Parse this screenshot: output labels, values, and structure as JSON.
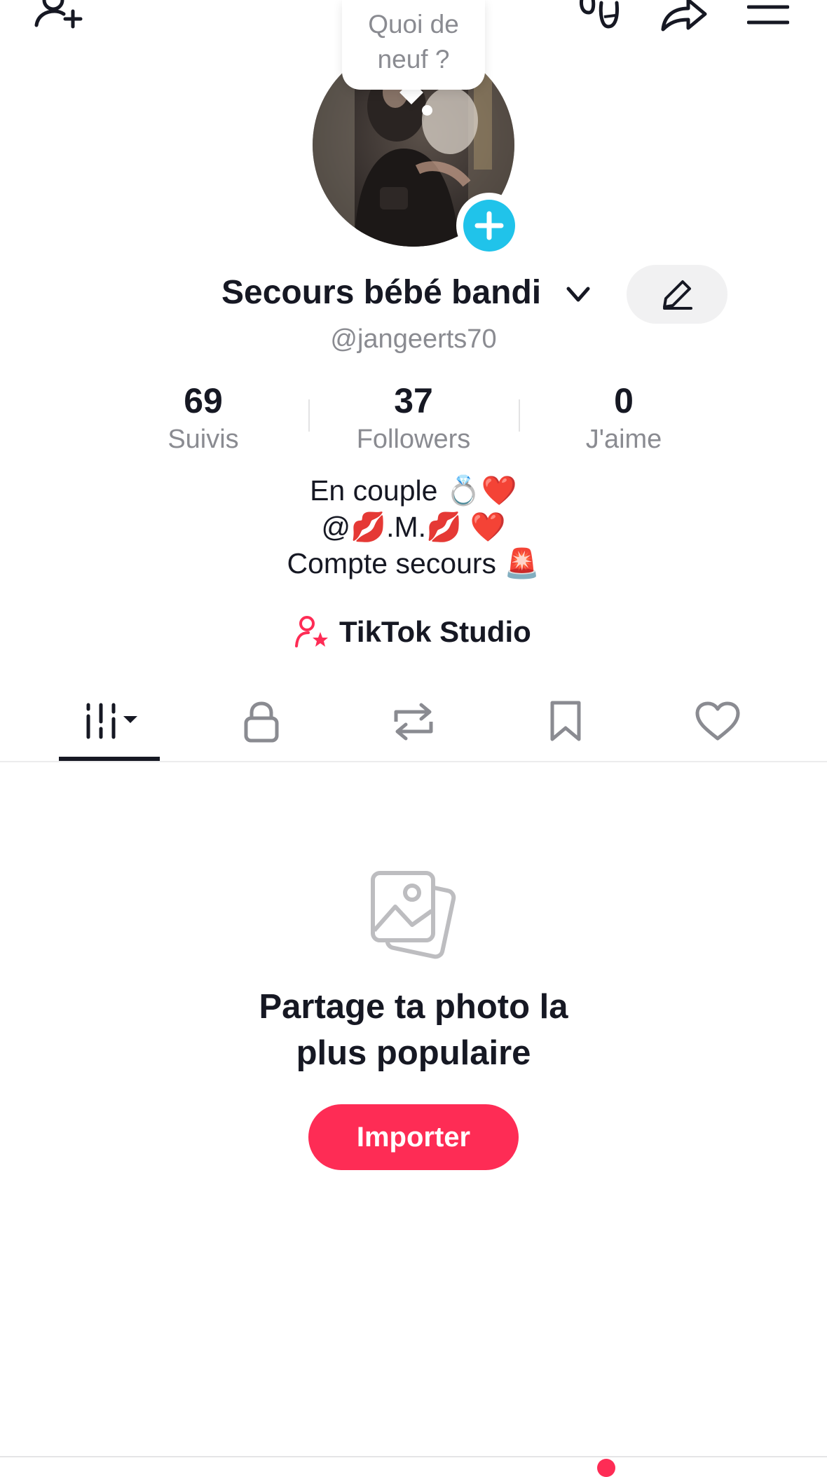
{
  "top_bar": {
    "add_friend_icon": "person-plus-icon",
    "footprints_icon": "footprints-icon",
    "share_icon": "share-arrow-icon",
    "menu_icon": "hamburger-menu-icon"
  },
  "status_bubble": {
    "line1": "Quoi de",
    "line2": "neuf ?"
  },
  "profile": {
    "display_name": "Secours bébé bandi",
    "handle": "@jangeerts70"
  },
  "stats": [
    {
      "value": "69",
      "label": "Suivis"
    },
    {
      "value": "37",
      "label": "Followers"
    },
    {
      "value": "0",
      "label": "J'aime"
    }
  ],
  "bio": {
    "line1": "En couple 💍❤️",
    "line2": "@💋.M.💋 ❤️",
    "line3": "Compte secours 🚨"
  },
  "studio": {
    "label": "TikTok Studio"
  },
  "tabs": [
    {
      "name": "grid-filter",
      "icon": "grid-dropdown-icon",
      "active": true
    },
    {
      "name": "private",
      "icon": "lock-icon",
      "active": false
    },
    {
      "name": "reposts",
      "icon": "repost-icon",
      "active": false
    },
    {
      "name": "favorites",
      "icon": "bookmark-icon",
      "active": false
    },
    {
      "name": "liked",
      "icon": "heart-icon",
      "active": false
    }
  ],
  "empty_state": {
    "title_line1": "Partage ta photo la",
    "title_line2": "plus populaire",
    "button_label": "Importer"
  },
  "colors": {
    "accent": "#fe2c55",
    "add_badge": "#20c3ea",
    "text": "#161823",
    "muted": "#8a8b91"
  }
}
